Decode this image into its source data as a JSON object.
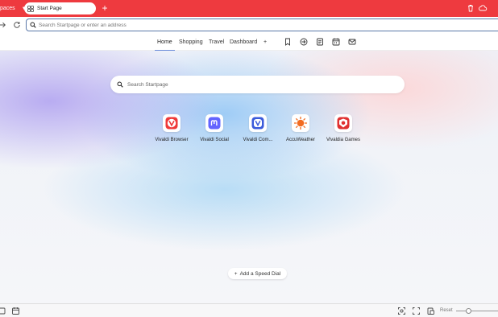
{
  "tabbar": {
    "workspaces_label": "paces",
    "active_tab_title": "Start Page",
    "new_tab_glyph": "+",
    "icons": [
      "trash-icon",
      "cloud-sync-icon"
    ],
    "accent_color": "#ee3a3f"
  },
  "addressbar": {
    "placeholder": "Search Startpage or enter an address",
    "value": ""
  },
  "startpage_nav": {
    "tabs": [
      {
        "label": "Home",
        "active": true
      },
      {
        "label": "Shopping",
        "active": false
      },
      {
        "label": "Travel",
        "active": false
      },
      {
        "label": "Dashboard",
        "active": false
      }
    ],
    "add_label": "+",
    "icons": [
      "bookmarks-icon",
      "history-icon",
      "notes-icon",
      "calendar-icon",
      "mail-icon"
    ]
  },
  "search": {
    "placeholder": "Search Startpage"
  },
  "speed_dials": [
    {
      "label": "Vivaldi Browser",
      "icon": "vivaldi-icon",
      "color": "#ef3939"
    },
    {
      "label": "Vivaldi Social",
      "icon": "mastodon-icon",
      "color": "#6364ff"
    },
    {
      "label": "Vivaldi Com...",
      "icon": "vivaldi-community-icon",
      "color": "#3b5bdb"
    },
    {
      "label": "AccuWeather",
      "icon": "sun-icon",
      "color": "#f26b21"
    },
    {
      "label": "Vivaldia Games",
      "icon": "games-icon",
      "color": "#e03131"
    }
  ],
  "add_speed_dial": {
    "label": "Add a Speed Dial",
    "glyph": "+"
  },
  "statusbar": {
    "reset_label": "Reset",
    "icons": [
      "window-icon",
      "calendar-icon",
      "capture-icon",
      "tile-icon",
      "image-icon"
    ]
  }
}
